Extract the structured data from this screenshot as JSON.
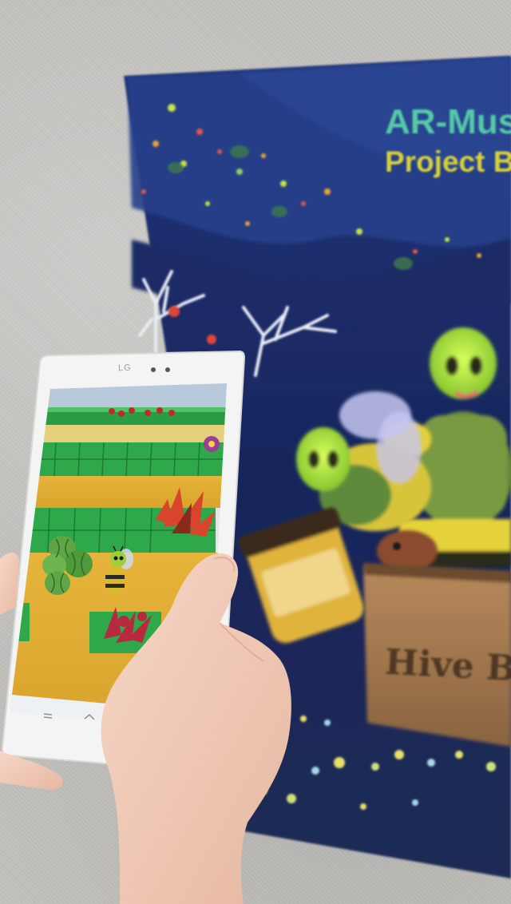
{
  "poster": {
    "title": "AR-Mus",
    "subtitle": "Project B",
    "crate_label": "Hive B"
  },
  "tablet": {
    "brand": "LG"
  },
  "colors": {
    "wall": "#c2c1bd",
    "poster_bg": "#1d2a55",
    "title": "#56c9a6",
    "subtitle": "#d7d13a",
    "game_path": "#e8b332",
    "game_hedge": "#2ea84a",
    "tablet_body": "#f4f4f4",
    "skin": "#f0c9b5"
  }
}
